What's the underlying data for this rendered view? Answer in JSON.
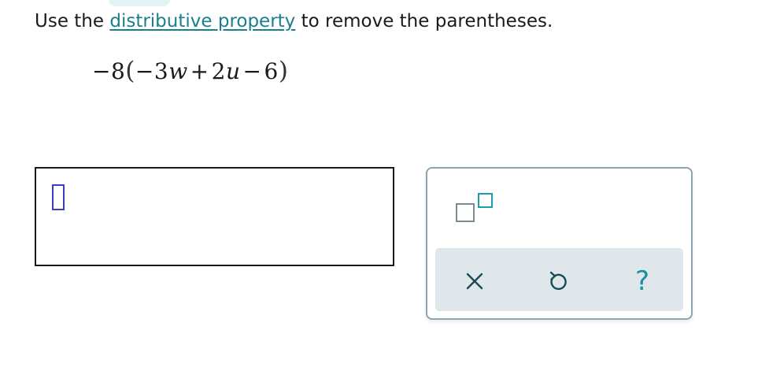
{
  "instruction": {
    "prefix": "Use the ",
    "link": "distributive property",
    "suffix": " to remove the parentheses."
  },
  "expression": {
    "coef_sign": "−",
    "coef": "8",
    "open_paren": "(",
    "term1_sign": "−",
    "term1_coef": "3",
    "term1_var": "w",
    "op2": "+",
    "term2_coef": "2",
    "term2_var": "u",
    "op3": "−",
    "term3": "6",
    "close_paren": ")"
  },
  "palette": {
    "tools": [
      "superscript-template"
    ],
    "actions": [
      "clear-icon",
      "undo-icon",
      "help-icon"
    ],
    "help_glyph": "?"
  },
  "colors": {
    "link": "#1b7f8c",
    "accent": "#1b9eb0",
    "cursor_slot": "#3b3fbf",
    "action_bar": "#e0e7ea",
    "palette_border": "#8ea5ad"
  }
}
